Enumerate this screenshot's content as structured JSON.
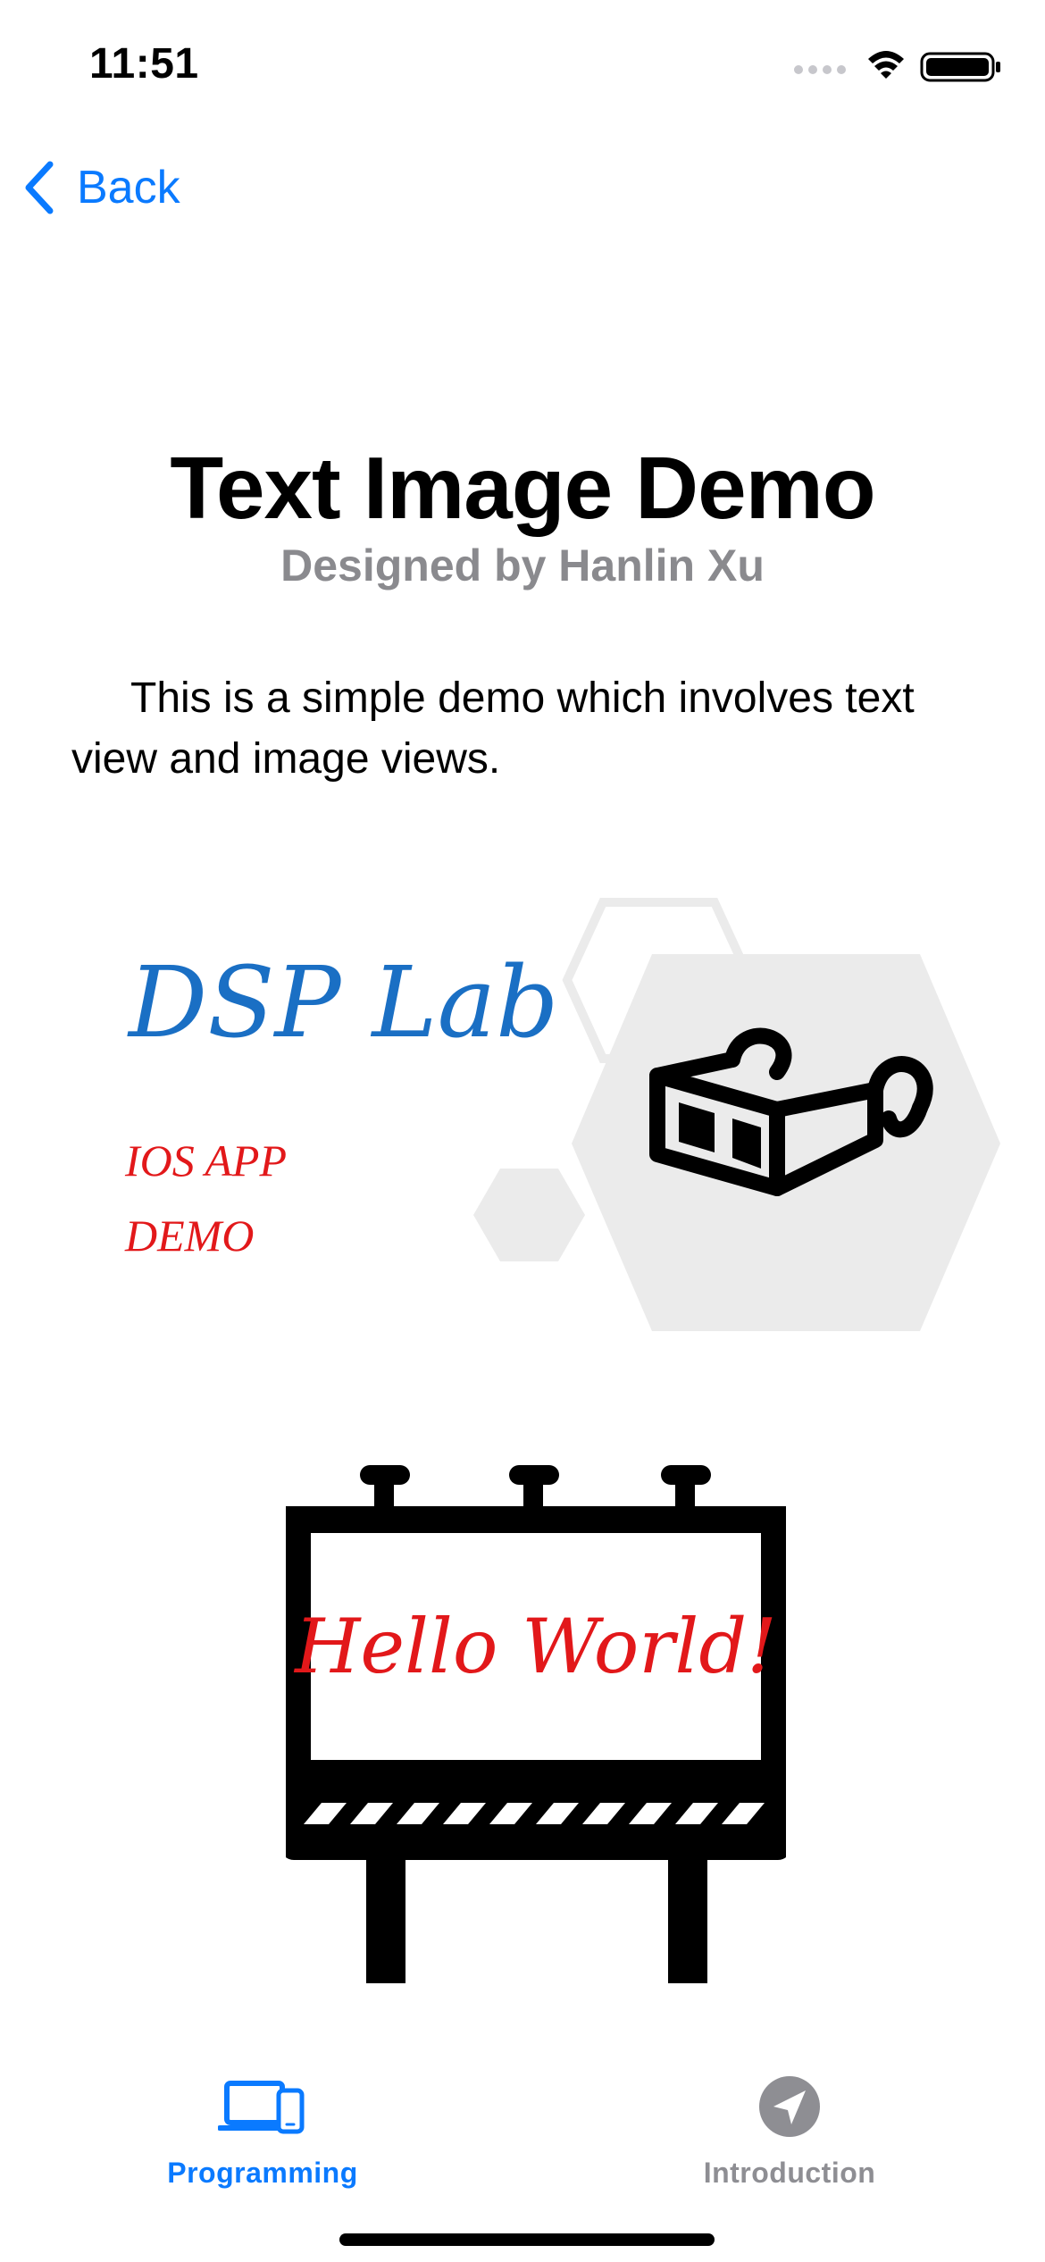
{
  "status_bar": {
    "time": "11:51",
    "icons": [
      "signal-dots-icon",
      "wifi-icon",
      "battery-icon"
    ]
  },
  "nav": {
    "back_label": "Back",
    "back_icon": "chevron-left-icon"
  },
  "header": {
    "title": "Text Image Demo",
    "subtitle": "Designed by Hanlin Xu"
  },
  "description": "This is a simple demo which involves text view and image views.",
  "graphics": {
    "dsp": {
      "title_text": "DSP Lab",
      "line1": "IOS APP",
      "line2": "DEMO",
      "icon": "3d-glasses-icon"
    },
    "billboard": {
      "text": "Hello World!",
      "icon": "billboard-icon"
    }
  },
  "tab_bar": {
    "tabs": [
      {
        "label": "Programming",
        "icon": "devices-icon",
        "selected": true
      },
      {
        "label": "Introduction",
        "icon": "location-arrow-icon",
        "selected": false
      }
    ]
  },
  "colors": {
    "accent": "#0A7AFF",
    "subtitle_gray": "#8A8A8E",
    "tab_inactive": "#8E8E93",
    "dsp_blue": "#1A6FC4",
    "red_text": "#E2181A",
    "hexagon_gray": "#EBEBEB"
  }
}
